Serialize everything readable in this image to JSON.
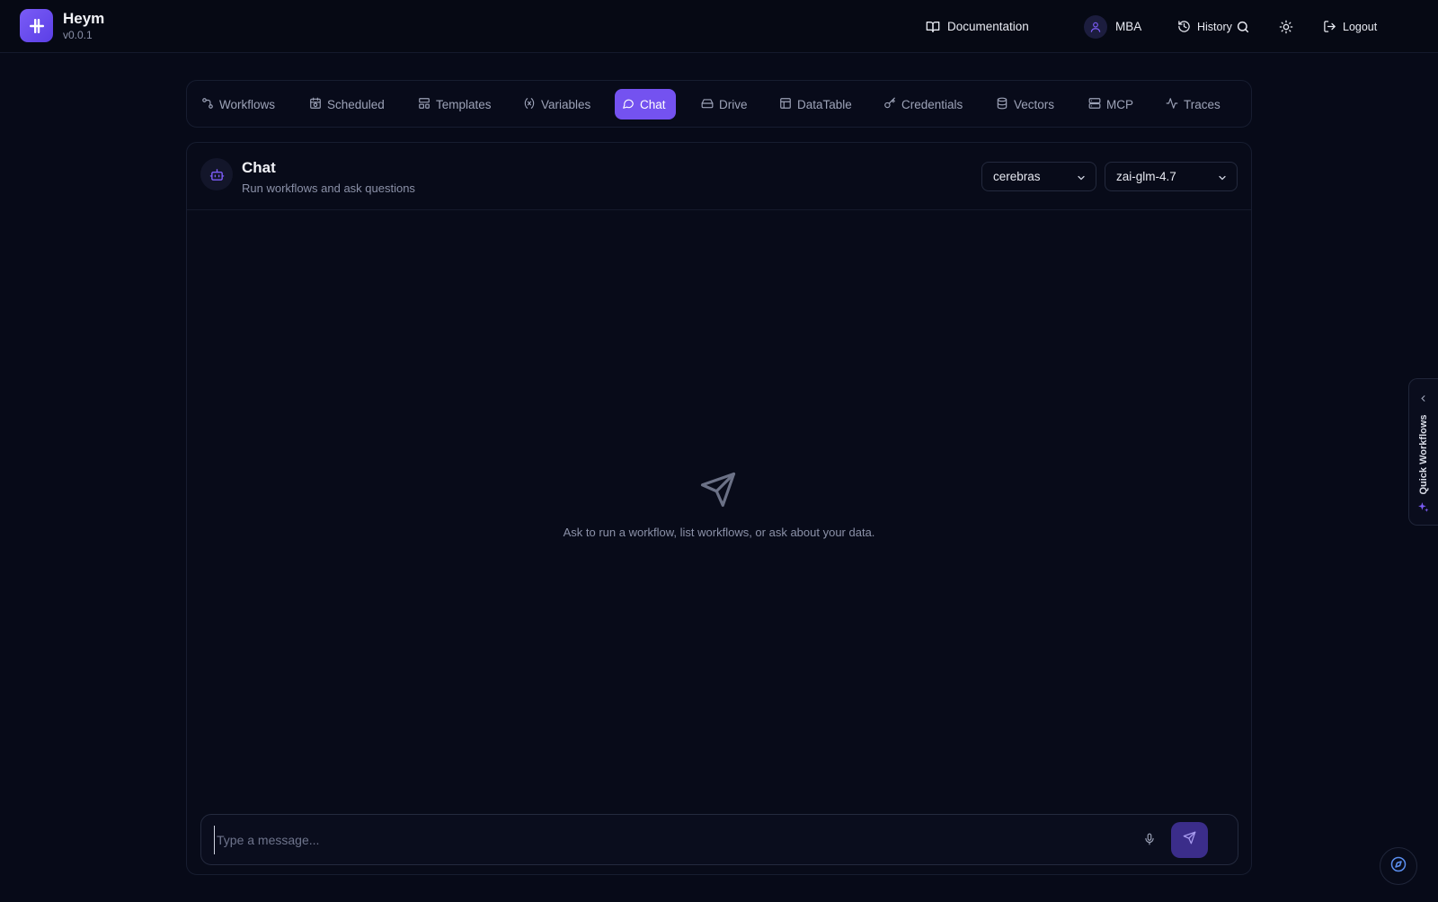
{
  "app": {
    "name": "Heym",
    "version": "v0.0.1"
  },
  "topbar": {
    "documentation": "Documentation",
    "user": "MBA",
    "history": "History",
    "logout": "Logout"
  },
  "nav": {
    "tabs": [
      {
        "label": "Workflows",
        "icon": "workflow-icon"
      },
      {
        "label": "Scheduled",
        "icon": "calendar-clock-icon"
      },
      {
        "label": "Templates",
        "icon": "layout-template-icon"
      },
      {
        "label": "Variables",
        "icon": "variable-icon"
      },
      {
        "label": "Chat",
        "icon": "chat-bubble-icon",
        "active": true
      },
      {
        "label": "Drive",
        "icon": "hard-drive-icon"
      },
      {
        "label": "DataTable",
        "icon": "table-icon"
      },
      {
        "label": "Credentials",
        "icon": "key-icon"
      },
      {
        "label": "Vectors",
        "icon": "database-icon"
      },
      {
        "label": "MCP",
        "icon": "server-icon"
      },
      {
        "label": "Traces",
        "icon": "activity-icon"
      }
    ]
  },
  "chat": {
    "title": "Chat",
    "subtitle": "Run workflows and ask questions",
    "provider": "cerebras",
    "model": "zai-glm-4.7",
    "empty_text": "Ask to run a workflow, list workflows, or ask about your data.",
    "input_placeholder": "Type a message..."
  },
  "quick_workflows": {
    "label": "Quick Workflows"
  },
  "colors": {
    "accent": "#7452f0",
    "background": "#070a18",
    "panel": "#080b19",
    "muted_text": "#8b91a8"
  }
}
